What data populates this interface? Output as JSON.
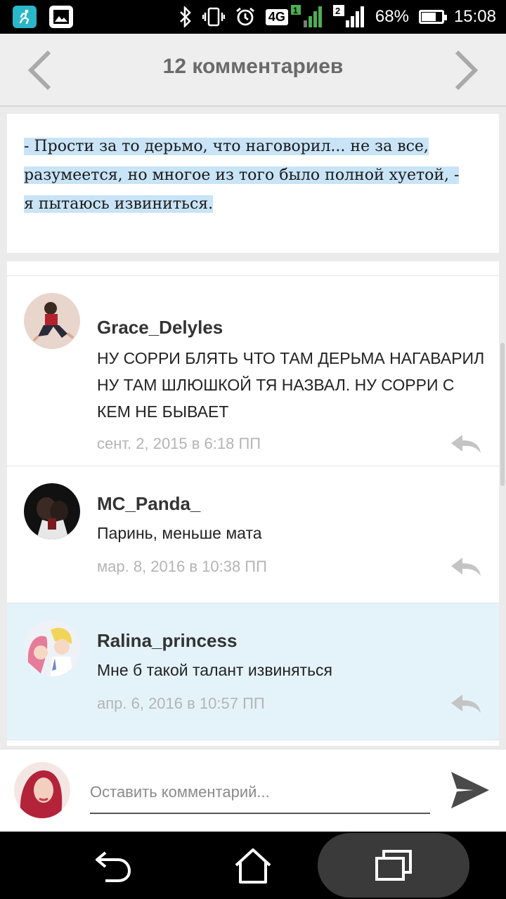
{
  "status_bar": {
    "battery_percent": "68%",
    "time": "15:08",
    "network": "4G",
    "sim1_label": "1",
    "sim2_label": "2",
    "icons": [
      "runner-app-icon",
      "gallery-icon",
      "bluetooth-icon",
      "vibrate-icon",
      "alarm-icon",
      "signal-icon",
      "battery-icon"
    ]
  },
  "header": {
    "title": "12 комментариев"
  },
  "story": {
    "text": "- Прости за то дерьмо, что наговорил... не за все, разумеется, но многое из того было полной хуетой, - я пытаюсь извиниться."
  },
  "comments": [
    {
      "user": "Grace_Delyles",
      "text": "НУ СОРРИ БЛЯТЬ ЧТО ТАМ ДЕРЬМА НАГАВАРИЛ НУ ТАМ ШЛЮШКОЙ ТЯ НАЗВАЛ. НУ СОРРИ С КЕМ НЕ БЫВАЕТ",
      "date": "сент. 2, 2015 в 6:18 ПП"
    },
    {
      "user": "MC_Panda_",
      "text": "Паринь, меньше мата",
      "date": "мар. 8, 2016 в 10:38 ПП"
    },
    {
      "user": "Ralina_princess",
      "text": "Мне б такой талант извиняться",
      "date": "апр. 6, 2016 в 10:57 ПП"
    }
  ],
  "input": {
    "placeholder": "Оставить комментарий...",
    "value": ""
  },
  "colors": {
    "highlight": "#c9e4f7",
    "selected_comment_bg": "#e4f3fa",
    "runner_icon": "#2ab7c9"
  }
}
